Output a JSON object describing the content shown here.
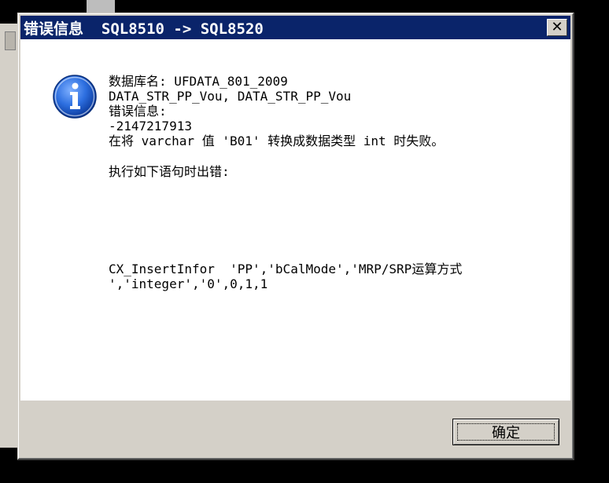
{
  "dialog": {
    "title": "错误信息  SQL8510 -> SQL8520",
    "close_symbol": "✕",
    "icon": "info-icon",
    "message_lines": [
      "数据库名: UFDATA_801_2009",
      "DATA_STR_PP_Vou, DATA_STR_PP_Vou",
      "错误信息:",
      "-2147217913",
      "在将 varchar 值 'B01' 转换成数据类型 int 时失败。"
    ],
    "exec_line": "执行如下语句时出错:",
    "sql_lines": [
      "CX_InsertInfor  'PP','bCalMode','MRP/SRP运算方式",
      "','integer','0',0,1,1"
    ],
    "ok_label": "确定"
  },
  "colors": {
    "title_bar": "#0a246a",
    "dialog_face": "#d4d0c8",
    "content_bg": "#ffffff",
    "icon_blue": "#1f5fd0"
  }
}
